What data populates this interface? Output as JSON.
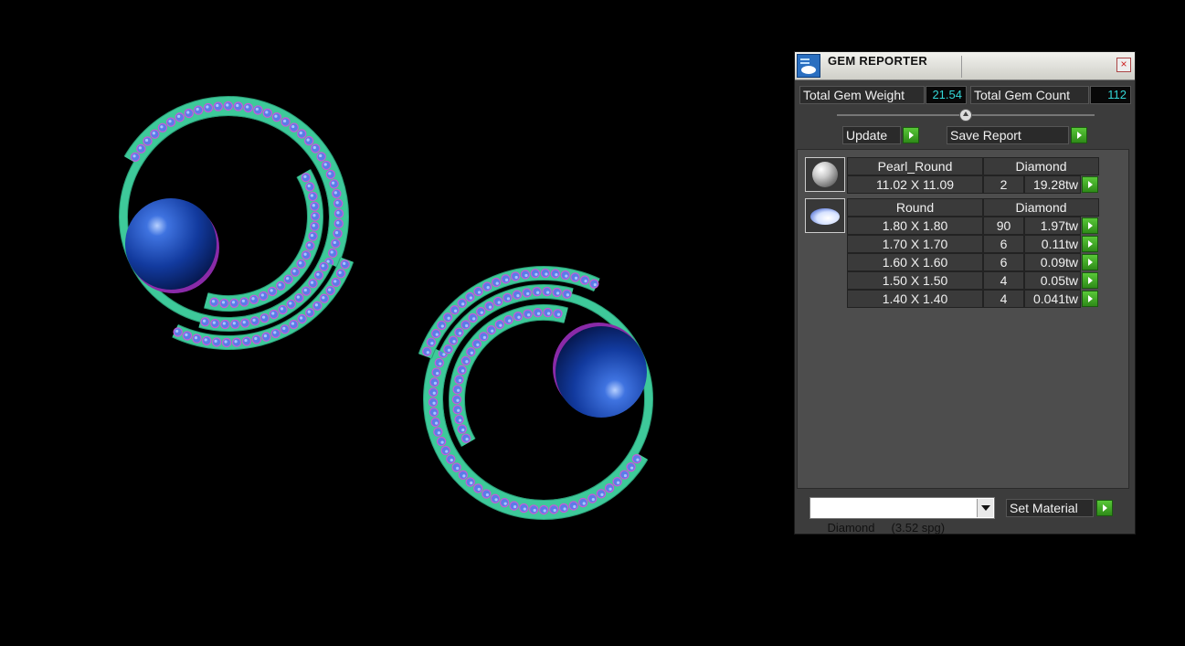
{
  "window": {
    "title": "GEM REPORTER",
    "close_glyph": "×"
  },
  "summary": {
    "weight_label": "Total Gem Weight",
    "weight_value": "21.54",
    "count_label": "Total Gem Count",
    "count_value": "112"
  },
  "actions": {
    "update_label": "Update",
    "save_label": "Save Report"
  },
  "groups": [
    {
      "icon": "pearl-icon",
      "shape": "Pearl_Round",
      "material": "Diamond",
      "rows": [
        {
          "size": "11.02 X 11.09",
          "count": "2",
          "weight": "19.28tw"
        }
      ]
    },
    {
      "icon": "round-gem-icon",
      "shape": "Round",
      "material": "Diamond",
      "rows": [
        {
          "size": "1.80 X 1.80",
          "count": "90",
          "weight": "1.97tw"
        },
        {
          "size": "1.70 X 1.70",
          "count": "6",
          "weight": "0.11tw"
        },
        {
          "size": "1.60 X 1.60",
          "count": "6",
          "weight": "0.09tw"
        },
        {
          "size": "1.50 X 1.50",
          "count": "4",
          "weight": "0.05tw"
        },
        {
          "size": "1.40 X 1.40",
          "count": "4",
          "weight": "0.041tw"
        }
      ]
    }
  ],
  "material": {
    "selected": "Diamond     (3.52 spg)",
    "set_label": "Set Material"
  },
  "colors": {
    "band": "#3ec99a",
    "band_edge": "#2a9f77",
    "gem": "#5b7de8",
    "prong": "#c85ad8",
    "pearl": "#1a48b8",
    "pearl_ring": "#8a2aa8",
    "value_text": "#33d6d6",
    "play_green": "#3aa020"
  },
  "slider": {
    "level": 0.5
  }
}
